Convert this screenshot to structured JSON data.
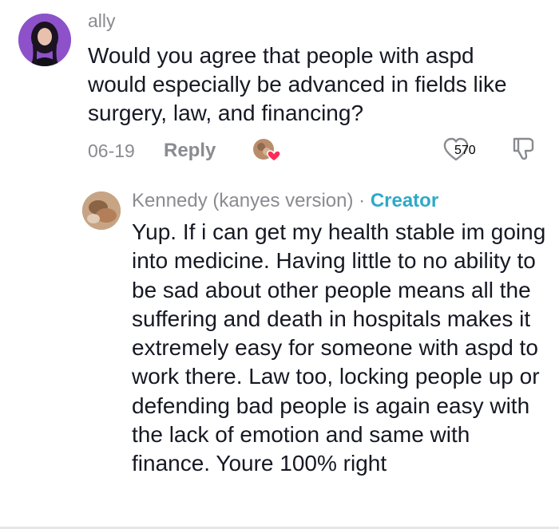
{
  "comment": {
    "username": "ally",
    "text": "Would you agree that people with aspd would especially be advanced in fields like surgery, law, and financing?",
    "date": "06-19",
    "reply_label": "Reply",
    "like_count": "570",
    "icons": {
      "like": "heart-outline-icon",
      "dislike": "thumbs-down-icon",
      "creator_liked": "creator-liked-heart-icon"
    }
  },
  "reply": {
    "username": "Kennedy (kanyes version)",
    "separator": " · ",
    "creator_label": "Creator",
    "text": "Yup. If i can get my health stable im going into medicine. Having little to no ability to be sad about other people means all the suffering and death in hospitals makes it extremely easy for someone with aspd to work there. Law too, locking people up or defending bad people is again easy with the lack of emotion and same with finance. Youre 100% right"
  },
  "colors": {
    "text_primary": "#161823",
    "text_secondary": "#8a8b91",
    "creator": "#2ea9c9",
    "heart_red": "#fe2c55"
  }
}
